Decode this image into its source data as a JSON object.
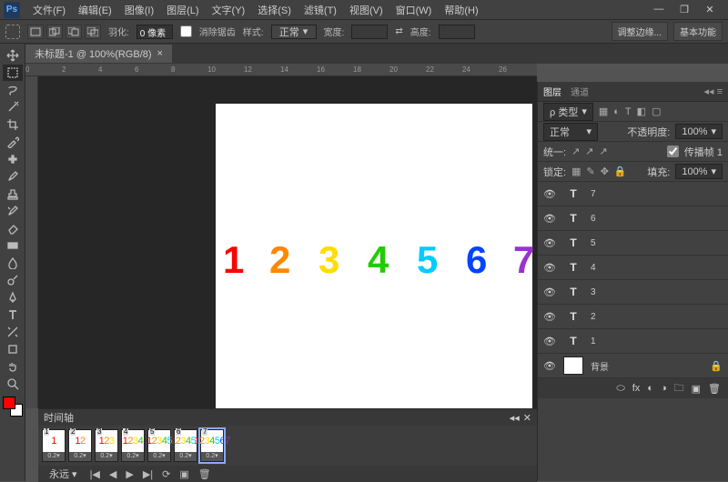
{
  "app": {
    "logo": "Ps"
  },
  "menu": [
    "文件(F)",
    "编辑(E)",
    "图像(I)",
    "图层(L)",
    "文字(Y)",
    "选择(S)",
    "滤镜(T)",
    "视图(V)",
    "窗口(W)",
    "帮助(H)"
  ],
  "window_controls": [
    "—",
    "❐",
    "✕"
  ],
  "optbar": {
    "feather_label": "羽化:",
    "feather_value": "0 像素",
    "antialias": "消除锯齿",
    "style_label": "样式:",
    "style_value": "正常",
    "width_label": "宽度:",
    "height_label": "高度:",
    "refine": "调整边缘...",
    "basic": "基本功能"
  },
  "doc_tab": {
    "title": "未标题-1 @ 100%(RGB/8)",
    "close": "×"
  },
  "ruler_marks": [
    "0",
    "2",
    "4",
    "6",
    "8",
    "10",
    "12",
    "14",
    "16",
    "18",
    "20",
    "22",
    "24",
    "26"
  ],
  "canvas_numbers": [
    "1",
    "2",
    "3",
    "4",
    "5",
    "6",
    "7"
  ],
  "layers_panel": {
    "tab_layers": "图层",
    "tab_channels": "通道",
    "kind": "ρ 类型",
    "blend": "正常",
    "opacity_label": "不透明度:",
    "opacity_value": "100%",
    "unify": "统一:",
    "propagate": "传播帧 1",
    "lock_label": "锁定:",
    "fill_label": "填充:",
    "fill_value": "100%",
    "layers": [
      {
        "name": "7"
      },
      {
        "name": "6"
      },
      {
        "name": "5"
      },
      {
        "name": "4"
      },
      {
        "name": "3"
      },
      {
        "name": "2"
      },
      {
        "name": "1"
      }
    ],
    "bg_layer": "背景"
  },
  "timeline": {
    "title": "时间轴",
    "frames": [
      {
        "n": "1",
        "d": "0.2▾"
      },
      {
        "n": "2",
        "d": "0.2▾"
      },
      {
        "n": "3",
        "d": "0.2▾"
      },
      {
        "n": "4",
        "d": "0.2▾"
      },
      {
        "n": "5",
        "d": "0.2▾"
      },
      {
        "n": "6",
        "d": "0.2▾"
      },
      {
        "n": "7",
        "d": "0.2▾"
      }
    ],
    "selected": 6,
    "loop": "永远"
  }
}
